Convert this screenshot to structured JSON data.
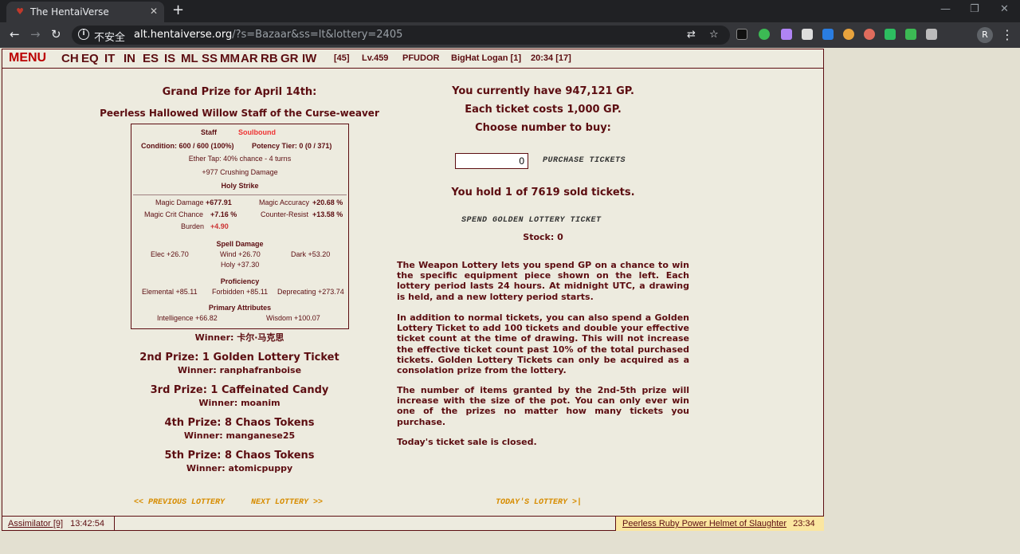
{
  "browser": {
    "tab_title": "The HentaiVerse",
    "tab_favicon": "hv-logo-icon",
    "omnibox": {
      "security_label": "不安全",
      "host": "alt.hentaiverse.org",
      "path": "/?s=Bazaar&ss=lt&lottery=2405"
    },
    "profile_initial": "R"
  },
  "menubar": {
    "menu_label": "MENU",
    "links": [
      "CH",
      "EQ",
      "IT",
      "IN",
      "ES",
      "IS",
      "ML",
      "SS",
      "MM",
      "AR",
      "RB",
      "GR",
      "IW"
    ],
    "level_bracket": "[45]",
    "level": "Lv.459",
    "difficulty": "PFUDOR",
    "player": "BigHat Logan [1]",
    "time": "20:34 [17]"
  },
  "grand_prize": {
    "heading": "Grand Prize for April 14th:",
    "item_name": "Peerless Hallowed Willow Staff of the Curse-weaver",
    "item": {
      "type": "Staff",
      "binding": "Soulbound",
      "condition": "Condition: 600 / 600 (100%)",
      "potency": "Potency Tier: 0 (0 / 371)",
      "ether_tap": "Ether Tap: 40% chance - 4 turns",
      "crushing": "+977 Crushing Damage",
      "holy_strike": "Holy Strike",
      "magic_damage_label": "Magic Damage",
      "magic_damage": "+677.91",
      "magic_accuracy_label": "Magic Accuracy",
      "magic_accuracy": "+20.68 %",
      "magic_crit_label": "Magic Crit Chance",
      "magic_crit": "+7.16 %",
      "counter_resist_label": "Counter-Resist",
      "counter_resist": "+13.58 %",
      "burden_label": "Burden",
      "burden": "+4.90",
      "spell_damage_heading": "Spell Damage",
      "elec": "Elec +26.70",
      "wind": "Wind +26.70",
      "dark": "Dark +53.20",
      "holy": "Holy +37.30",
      "proficiency_heading": "Proficiency",
      "elemental": "Elemental +85.11",
      "forbidden": "Forbidden +85.11",
      "deprecating": "Deprecating +273.74",
      "primary_heading": "Primary Attributes",
      "intelligence": "Intelligence +66.82",
      "wisdom": "Wisdom +100.07"
    },
    "winner": "Winner: 卡尔·马克思"
  },
  "prizes": [
    {
      "title": "2nd Prize: 1 Golden Lottery Ticket",
      "winner": "Winner: ranphafranboise"
    },
    {
      "title": "3rd Prize: 1 Caffeinated Candy",
      "winner": "Winner: moanim"
    },
    {
      "title": "4th Prize: 8 Chaos Tokens",
      "winner": "Winner: manganese25"
    },
    {
      "title": "5th Prize: 8 Chaos Tokens",
      "winner": "Winner: atomicpuppy"
    }
  ],
  "purchase": {
    "gp_line": "You currently have 947,121 GP.",
    "cost_line": "Each ticket costs 1,000 GP.",
    "choose_line": "Choose number to buy:",
    "quantity": "0",
    "purchase_button": "PURCHASE TICKETS",
    "hold_line": "You hold 1 of 7619 sold tickets.",
    "spend_button": "SPEND GOLDEN LOTTERY TICKET",
    "stock_line": "Stock: 0"
  },
  "description": [
    "The Weapon Lottery lets you spend GP on a chance to win the specific equipment piece shown on the left. Each lottery period lasts 24 hours. At midnight UTC, a drawing is held, and a new lottery period starts.",
    "In addition to normal tickets, you can also spend a Golden Lottery Ticket to add 100 tickets and double your effective ticket count at the time of drawing. This will not increase the effective ticket count past 10% of the total purchased tickets. Golden Lottery Tickets can only be acquired as a consolation prize from the lottery.",
    "The number of items granted by the 2nd-5th prize will increase with the size of the pot. You can only ever win one of the prizes no matter how many tickets you purchase.",
    "Today's ticket sale is closed."
  ],
  "nav": {
    "previous": "<< PREVIOUS LOTTERY",
    "next": "NEXT LOTTERY >>",
    "today": "TODAY'S LOTTERY >|"
  },
  "statusbar": {
    "left_link": "Assimilator [9]",
    "left_time": "13:42:54",
    "right_link": "Peerless Ruby Power Helmet of Slaughter",
    "right_time": "23:34"
  }
}
